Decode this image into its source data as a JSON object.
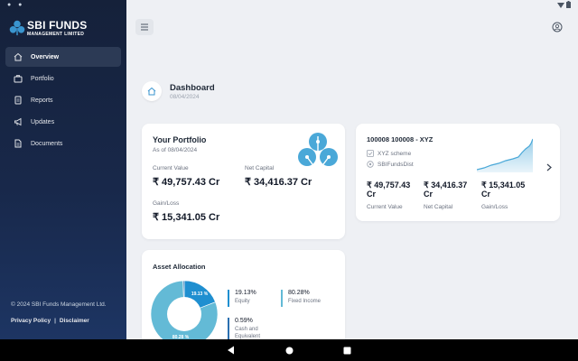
{
  "status_bar": {
    "left_indicator": "● ●",
    "wifi_icon": "▼",
    "battery_icon": "▮"
  },
  "sidebar": {
    "brand": "SBI FUNDS",
    "brand_sub": "MANAGEMENT LIMITED",
    "items": [
      {
        "label": "Overview",
        "icon": "home-icon",
        "active": true
      },
      {
        "label": "Portfolio",
        "icon": "briefcase-icon",
        "active": false
      },
      {
        "label": "Reports",
        "icon": "document-icon",
        "active": false
      },
      {
        "label": "Updates",
        "icon": "megaphone-icon",
        "active": false
      },
      {
        "label": "Documents",
        "icon": "file-icon",
        "active": false
      }
    ],
    "copyright": "© 2024 SBI Funds Management Ltd.",
    "privacy": "Privacy Policy",
    "separator": "|",
    "disclaimer": "Disclaimer"
  },
  "header": {
    "menu_icon": "menu-icon",
    "profile_icon": "profile-icon"
  },
  "dashboard": {
    "title": "Dashboard",
    "date": "08/04/2024"
  },
  "portfolio": {
    "title": "Your Portfolio",
    "as_of": "As of 08/04/2024",
    "current_value_label": "Current Value",
    "current_value": "₹ 49,757.43 Cr",
    "net_capital_label": "Net Capital",
    "net_capital": "₹ 34,416.37 Cr",
    "gain_loss_label": "Gain/Loss",
    "gain_loss": "₹ 15,341.05 Cr"
  },
  "scheme": {
    "title": "100008 100008 - XYZ",
    "scheme_name": "XYZ scheme",
    "distributor": "SBIFundsDist",
    "current_value": "₹ 49,757.43",
    "current_value_unit": "Cr",
    "net_capital": "₹ 34,416.37",
    "net_capital_unit": "Cr",
    "gain_loss": "₹ 15,341.05",
    "gain_loss_unit": "Cr",
    "current_value_label": "Current Value",
    "net_capital_label": "Net Capital",
    "gain_loss_label": "Gain/Loss",
    "accent": "#4aa8d8"
  },
  "allocation": {
    "title": "Asset Allocation",
    "slices": [
      {
        "name": "Equity",
        "pct": "19.13%",
        "value": 19.13,
        "color": "#1f8fd0",
        "label": "19.13 %"
      },
      {
        "name": "Fixed Income",
        "pct": "80.28%",
        "value": 80.28,
        "color": "#63bad6",
        "label": "80.28 %"
      },
      {
        "name": "Cash and Equivalent",
        "pct": "0.59%",
        "value": 0.59,
        "color": "#2a6fb0"
      }
    ]
  },
  "colors": {
    "sidebar_bg": "#15213a",
    "brand_blue": "#3a95cf",
    "page_bg": "#eef0f4"
  }
}
